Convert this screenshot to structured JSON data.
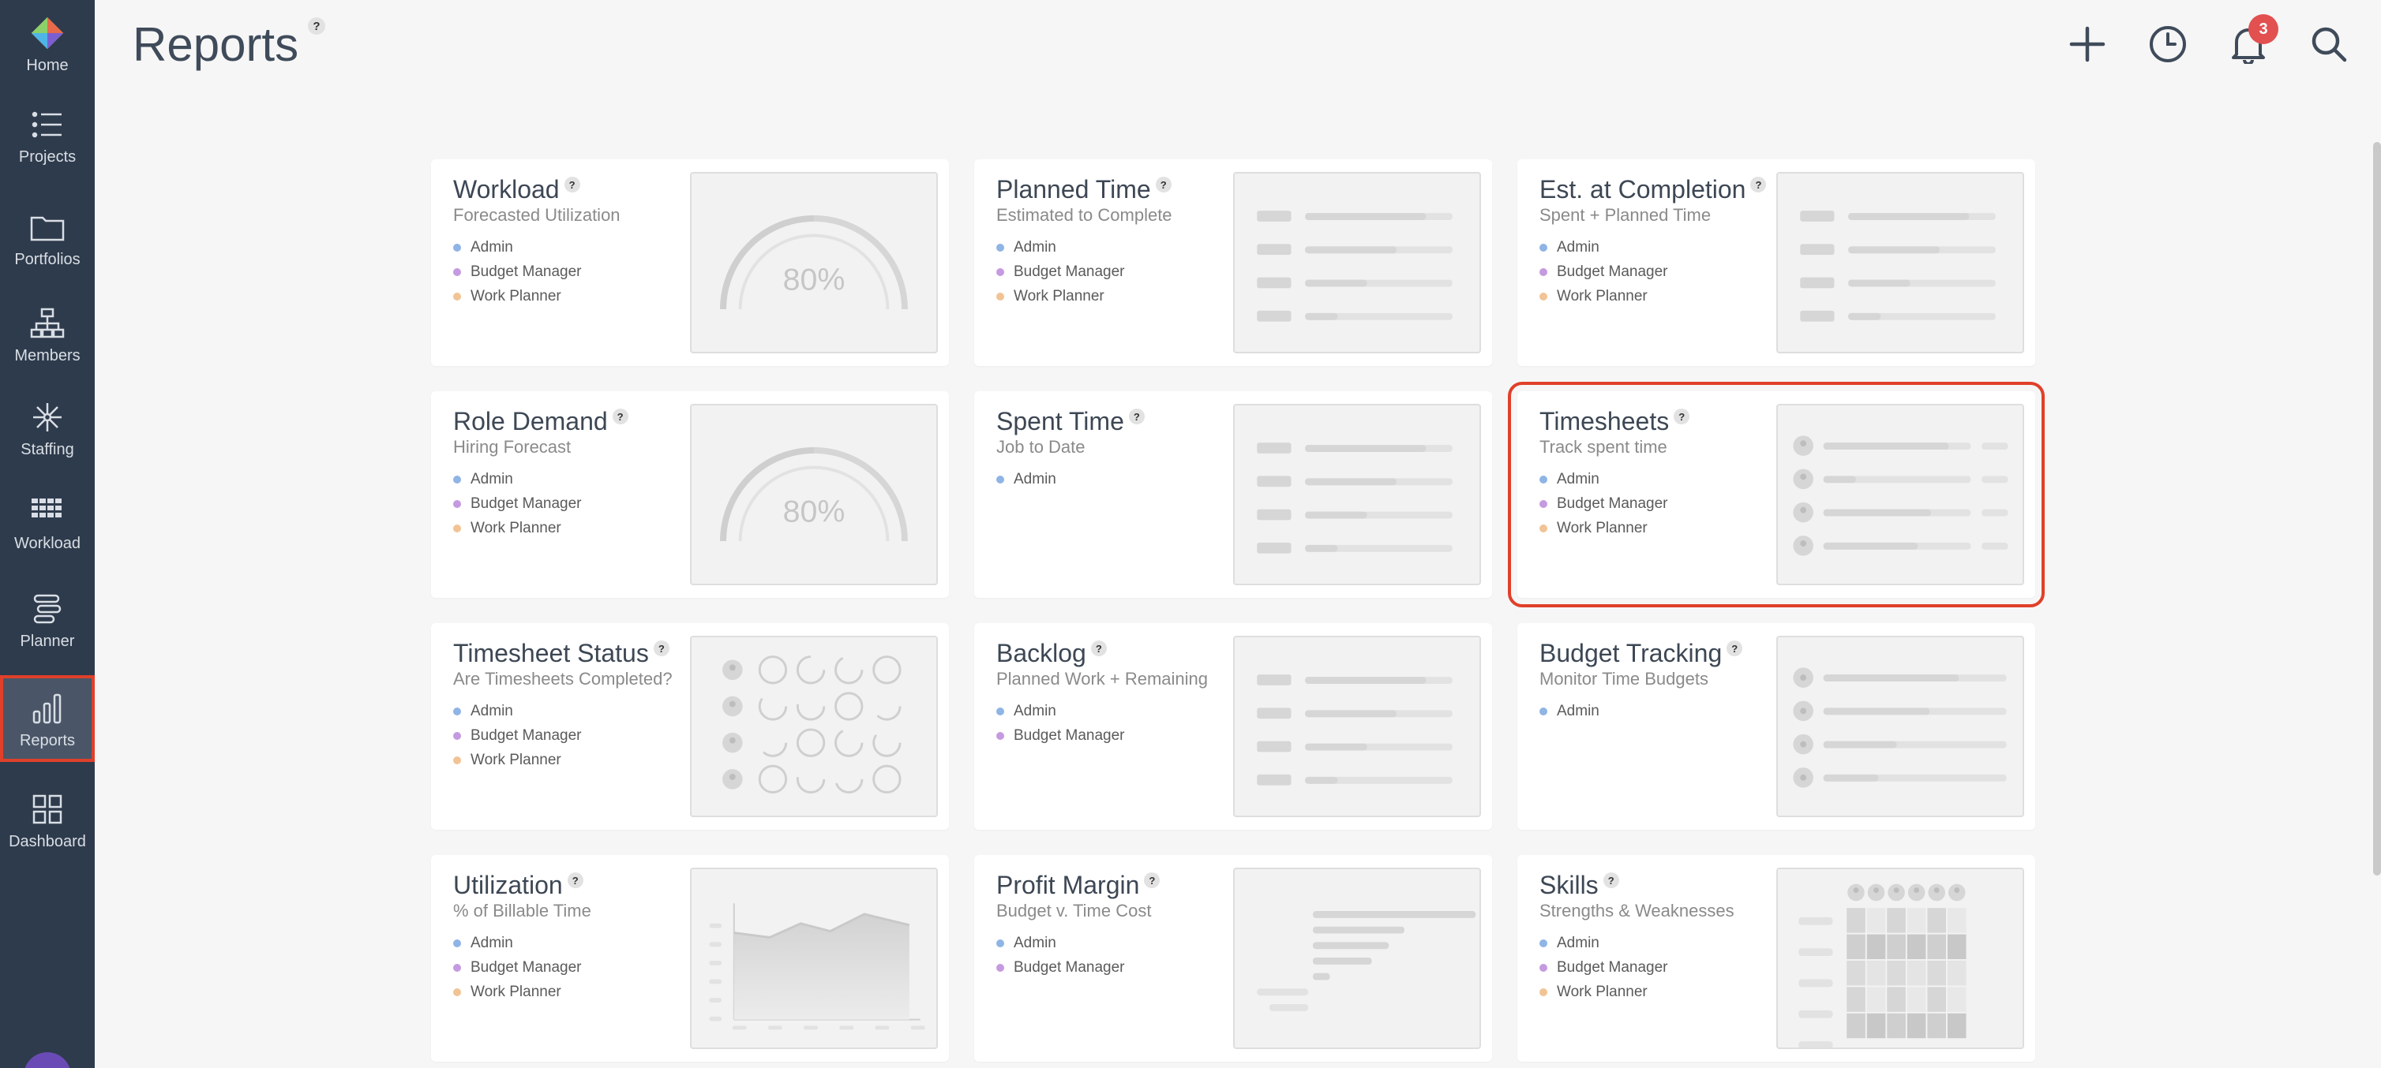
{
  "sidebar": {
    "items": [
      {
        "id": "home",
        "label": "Home",
        "icon": "home-logo-icon"
      },
      {
        "id": "projects",
        "label": "Projects",
        "icon": "list-icon"
      },
      {
        "id": "portfolios",
        "label": "Portfolios",
        "icon": "folder-icon"
      },
      {
        "id": "members",
        "label": "Members",
        "icon": "org-chart-icon"
      },
      {
        "id": "staffing",
        "label": "Staffing",
        "icon": "network-icon"
      },
      {
        "id": "workload",
        "label": "Workload",
        "icon": "grid-icon"
      },
      {
        "id": "planner",
        "label": "Planner",
        "icon": "planner-icon"
      },
      {
        "id": "reports",
        "label": "Reports",
        "icon": "bar-chart-icon",
        "active": true
      },
      {
        "id": "dashboard",
        "label": "Dashboard",
        "icon": "dashboard-icon"
      }
    ]
  },
  "header": {
    "title": "Reports",
    "help": "?",
    "notification_count": "3",
    "actions": [
      "plus-icon",
      "clock-icon",
      "bell-icon",
      "search-icon"
    ]
  },
  "colors": {
    "sidebar_bg": "#2e3b4c",
    "selection": "#e0402a",
    "admin_dot": "#8fb4e6",
    "budget_dot": "#c59ae0",
    "planner_dot": "#f2c394",
    "badge": "#e25050"
  },
  "roles": {
    "admin": "Admin",
    "budget": "Budget Manager",
    "planner": "Work Planner"
  },
  "cards": [
    {
      "title": "Workload",
      "subtitle": "Forecasted Utilization",
      "preview": "gauge",
      "preview_text": "80%",
      "roles": [
        "admin",
        "budget",
        "planner"
      ]
    },
    {
      "title": "Planned Time",
      "subtitle": "Estimated to Complete",
      "preview": "bars",
      "roles": [
        "admin",
        "budget",
        "planner"
      ]
    },
    {
      "title": "Est. at Completion",
      "subtitle": "Spent + Planned Time",
      "preview": "bars",
      "roles": [
        "admin",
        "budget",
        "planner"
      ]
    },
    {
      "title": "Role Demand",
      "subtitle": "Hiring Forecast",
      "preview": "gauge",
      "preview_text": "80%",
      "roles": [
        "admin",
        "budget",
        "planner"
      ]
    },
    {
      "title": "Spent Time",
      "subtitle": "Job to Date",
      "preview": "bars",
      "roles": [
        "admin"
      ]
    },
    {
      "title": "Timesheets",
      "subtitle": "Track spent time",
      "preview": "avatar-bars",
      "roles": [
        "admin",
        "budget",
        "planner"
      ],
      "selected": true
    },
    {
      "title": "Timesheet Status",
      "subtitle": "Are Timesheets Completed?",
      "preview": "circles",
      "roles": [
        "admin",
        "budget",
        "planner"
      ]
    },
    {
      "title": "Backlog",
      "subtitle": "Planned Work + Remaining",
      "preview": "bars",
      "roles": [
        "admin",
        "budget"
      ]
    },
    {
      "title": "Budget Tracking",
      "subtitle": "Monitor Time Budgets",
      "preview": "bullet-bars",
      "roles": [
        "admin"
      ]
    },
    {
      "title": "Utilization",
      "subtitle": "% of Billable Time",
      "preview": "area",
      "roles": [
        "admin",
        "budget",
        "planner"
      ]
    },
    {
      "title": "Profit Margin",
      "subtitle": "Budget v. Time Cost",
      "preview": "waterfall",
      "roles": [
        "admin",
        "budget"
      ]
    },
    {
      "title": "Skills",
      "subtitle": "Strengths & Weaknesses",
      "preview": "heatmap",
      "roles": [
        "admin",
        "budget",
        "planner"
      ]
    }
  ]
}
